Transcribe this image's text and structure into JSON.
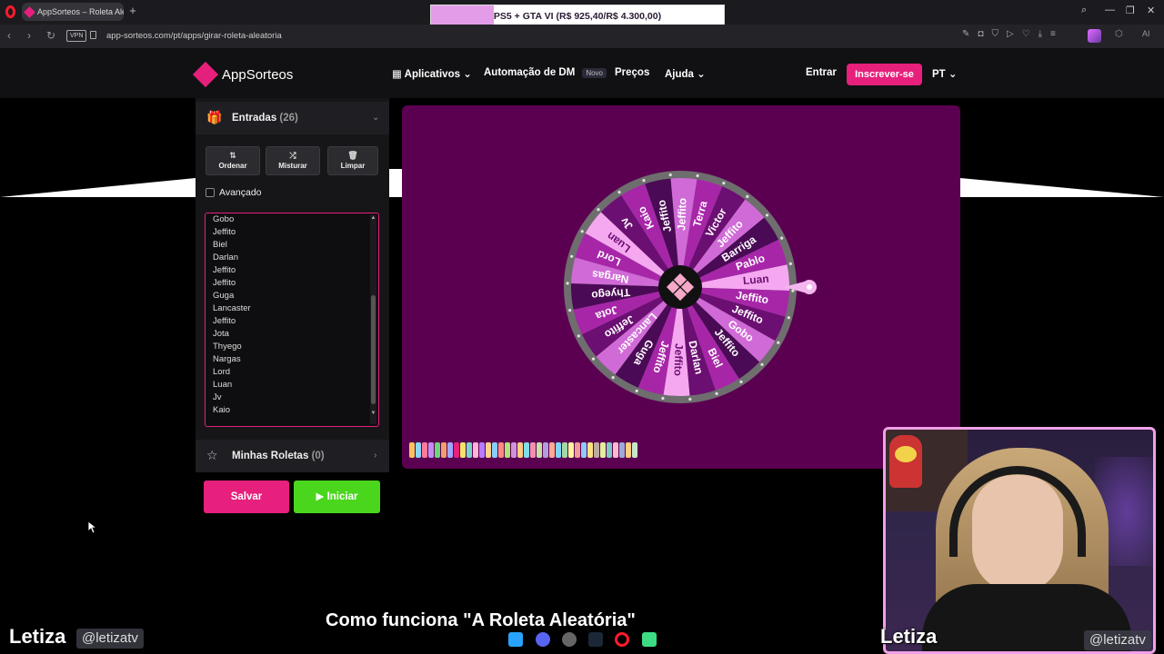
{
  "browser": {
    "tab_title": "AppSorteos – Roleta Alea",
    "new_tab": "+",
    "promo_text": "PS5 + GTA VI (R$ 925,40/R$ 4.300,00)",
    "promo_progress": 0.215,
    "vpn_label": "VPN",
    "url": "app-sorteos.com/pt/apps/girar-roleta-aleatoria",
    "ai_label": "AI"
  },
  "header": {
    "logo_text": "AppSorteos",
    "nav_apps": "Aplicativos",
    "nav_dm": "Automação de DM",
    "nav_dm_badge": "Novo",
    "nav_prices": "Preços",
    "nav_help": "Ajuda",
    "login": "Entrar",
    "signup": "Inscrever-se",
    "lang": "PT"
  },
  "entries_panel": {
    "title": "Entradas",
    "count": "(26)",
    "sort_label": "Ordenar",
    "shuffle_label": "Misturar",
    "clear_label": "Limpar",
    "advanced_label": "Avançado",
    "visible_entries": [
      "Gobo",
      "Jeffito",
      "Biel",
      "Darlan",
      "Jeffito",
      "Jeffito",
      "Guga",
      "Lancaster",
      "Jeffito",
      "Jota",
      "Thyego",
      "Nargas",
      "Lord",
      "Luan",
      "Jv",
      "Kaio"
    ]
  },
  "my_wheels": {
    "title": "Minhas Roletas",
    "count": "(0)"
  },
  "actions": {
    "save": "Salvar",
    "start": "Iniciar"
  },
  "wheel": {
    "segments": [
      "Luan",
      "Jeffito",
      "Jeffito",
      "Gobo",
      "Jeffito",
      "Biel",
      "Darlan",
      "Jeffito",
      "Jeffito",
      "Guga",
      "Lancaster",
      "Jeffito",
      "Jota",
      "Thyego",
      "Nargas",
      "Lord",
      "Luan",
      "Jv",
      "Kaio",
      "Jeffito",
      "Jeffito",
      "Terra",
      "Victor",
      "Jeffito",
      "Barriga",
      "Pablo"
    ],
    "colors": [
      "#f5a8f0",
      "#a726a8",
      "#6b0f72",
      "#d06ad6",
      "#4a0a55",
      "#a726a8",
      "#6b0f72",
      "#f5a8f0",
      "#a726a8",
      "#4a0a55",
      "#d06ad6",
      "#6b0f72",
      "#a726a8",
      "#4a0a55",
      "#d06ad6",
      "#a726a8",
      "#f5a8f0",
      "#6b0f72",
      "#a726a8",
      "#4a0a55",
      "#d06ad6",
      "#a726a8",
      "#6b0f72",
      "#d06ad6",
      "#4a0a55",
      "#a726a8"
    ],
    "palette": [
      "#f7c35f",
      "#8ad7f5",
      "#ff7a9a",
      "#c58cf0",
      "#6bd67a",
      "#f0a070",
      "#9fa8ff",
      "#e6207c",
      "#f5e26a",
      "#7bd7c9",
      "#ffb3d9",
      "#b57cff",
      "#ffd08a",
      "#87cefa",
      "#ff8a80",
      "#aee571",
      "#ce93d8",
      "#ffcc80",
      "#80deea",
      "#f48fb1",
      "#c5e1a5",
      "#b39ddb",
      "#ffab91",
      "#81d4fa",
      "#a5d6a7",
      "#fff59d",
      "#ef9a9a",
      "#90caf9",
      "#ffe082",
      "#bcaaa4",
      "#e6ee9c",
      "#80cbc4",
      "#f8bbd0",
      "#9fa8da",
      "#ffcc80",
      "#c8e6c9"
    ]
  },
  "section_heading": "Como funciona \"A Roleta Aleatória\"",
  "overlay": {
    "name": "Letiza",
    "handle": "@letizatv"
  }
}
